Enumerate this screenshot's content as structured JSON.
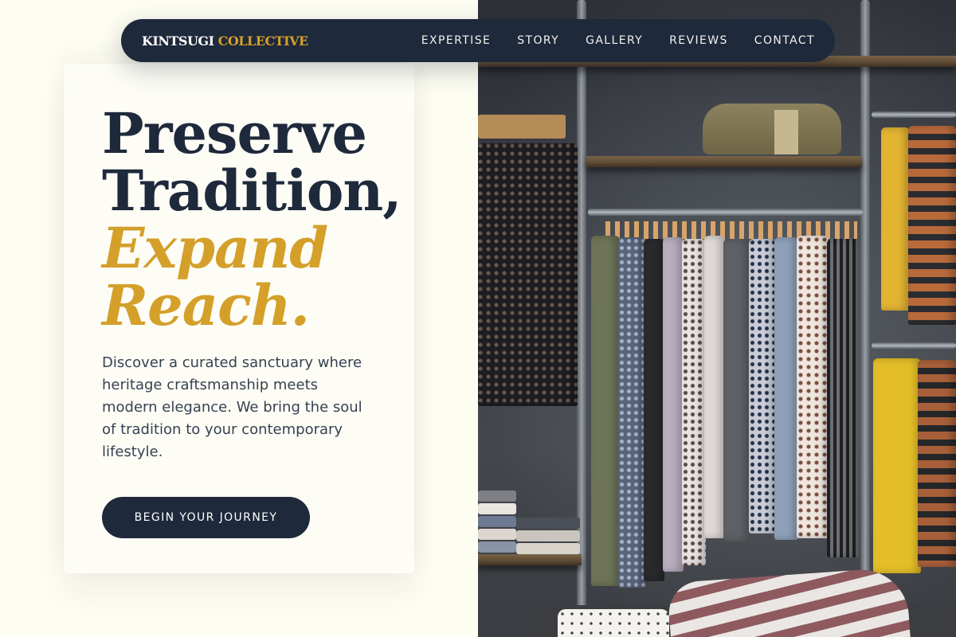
{
  "nav": {
    "brand": {
      "part1": "KINTSUGI",
      "part2": "COLLECTIVE"
    },
    "items": [
      {
        "label": "EXPERTISE"
      },
      {
        "label": "STORY"
      },
      {
        "label": "GALLERY"
      },
      {
        "label": "REVIEWS"
      },
      {
        "label": "CONTACT"
      }
    ]
  },
  "hero": {
    "headline": {
      "line1": "Preserve",
      "line2": "Tradition,",
      "line3": "Expand",
      "line4": "Reach."
    },
    "description": "Discover a curated sanctuary where heritage craftsmanship meets modern elegance. We bring the soul of tradition to your contemporary lifestyle.",
    "cta_label": "BEGIN YOUR JOURNEY"
  },
  "colors": {
    "navy": "#1e293b",
    "gold": "#d4a02a",
    "background": "#fdfdf2"
  },
  "image": {
    "subject": "clothing-rack-photo"
  }
}
